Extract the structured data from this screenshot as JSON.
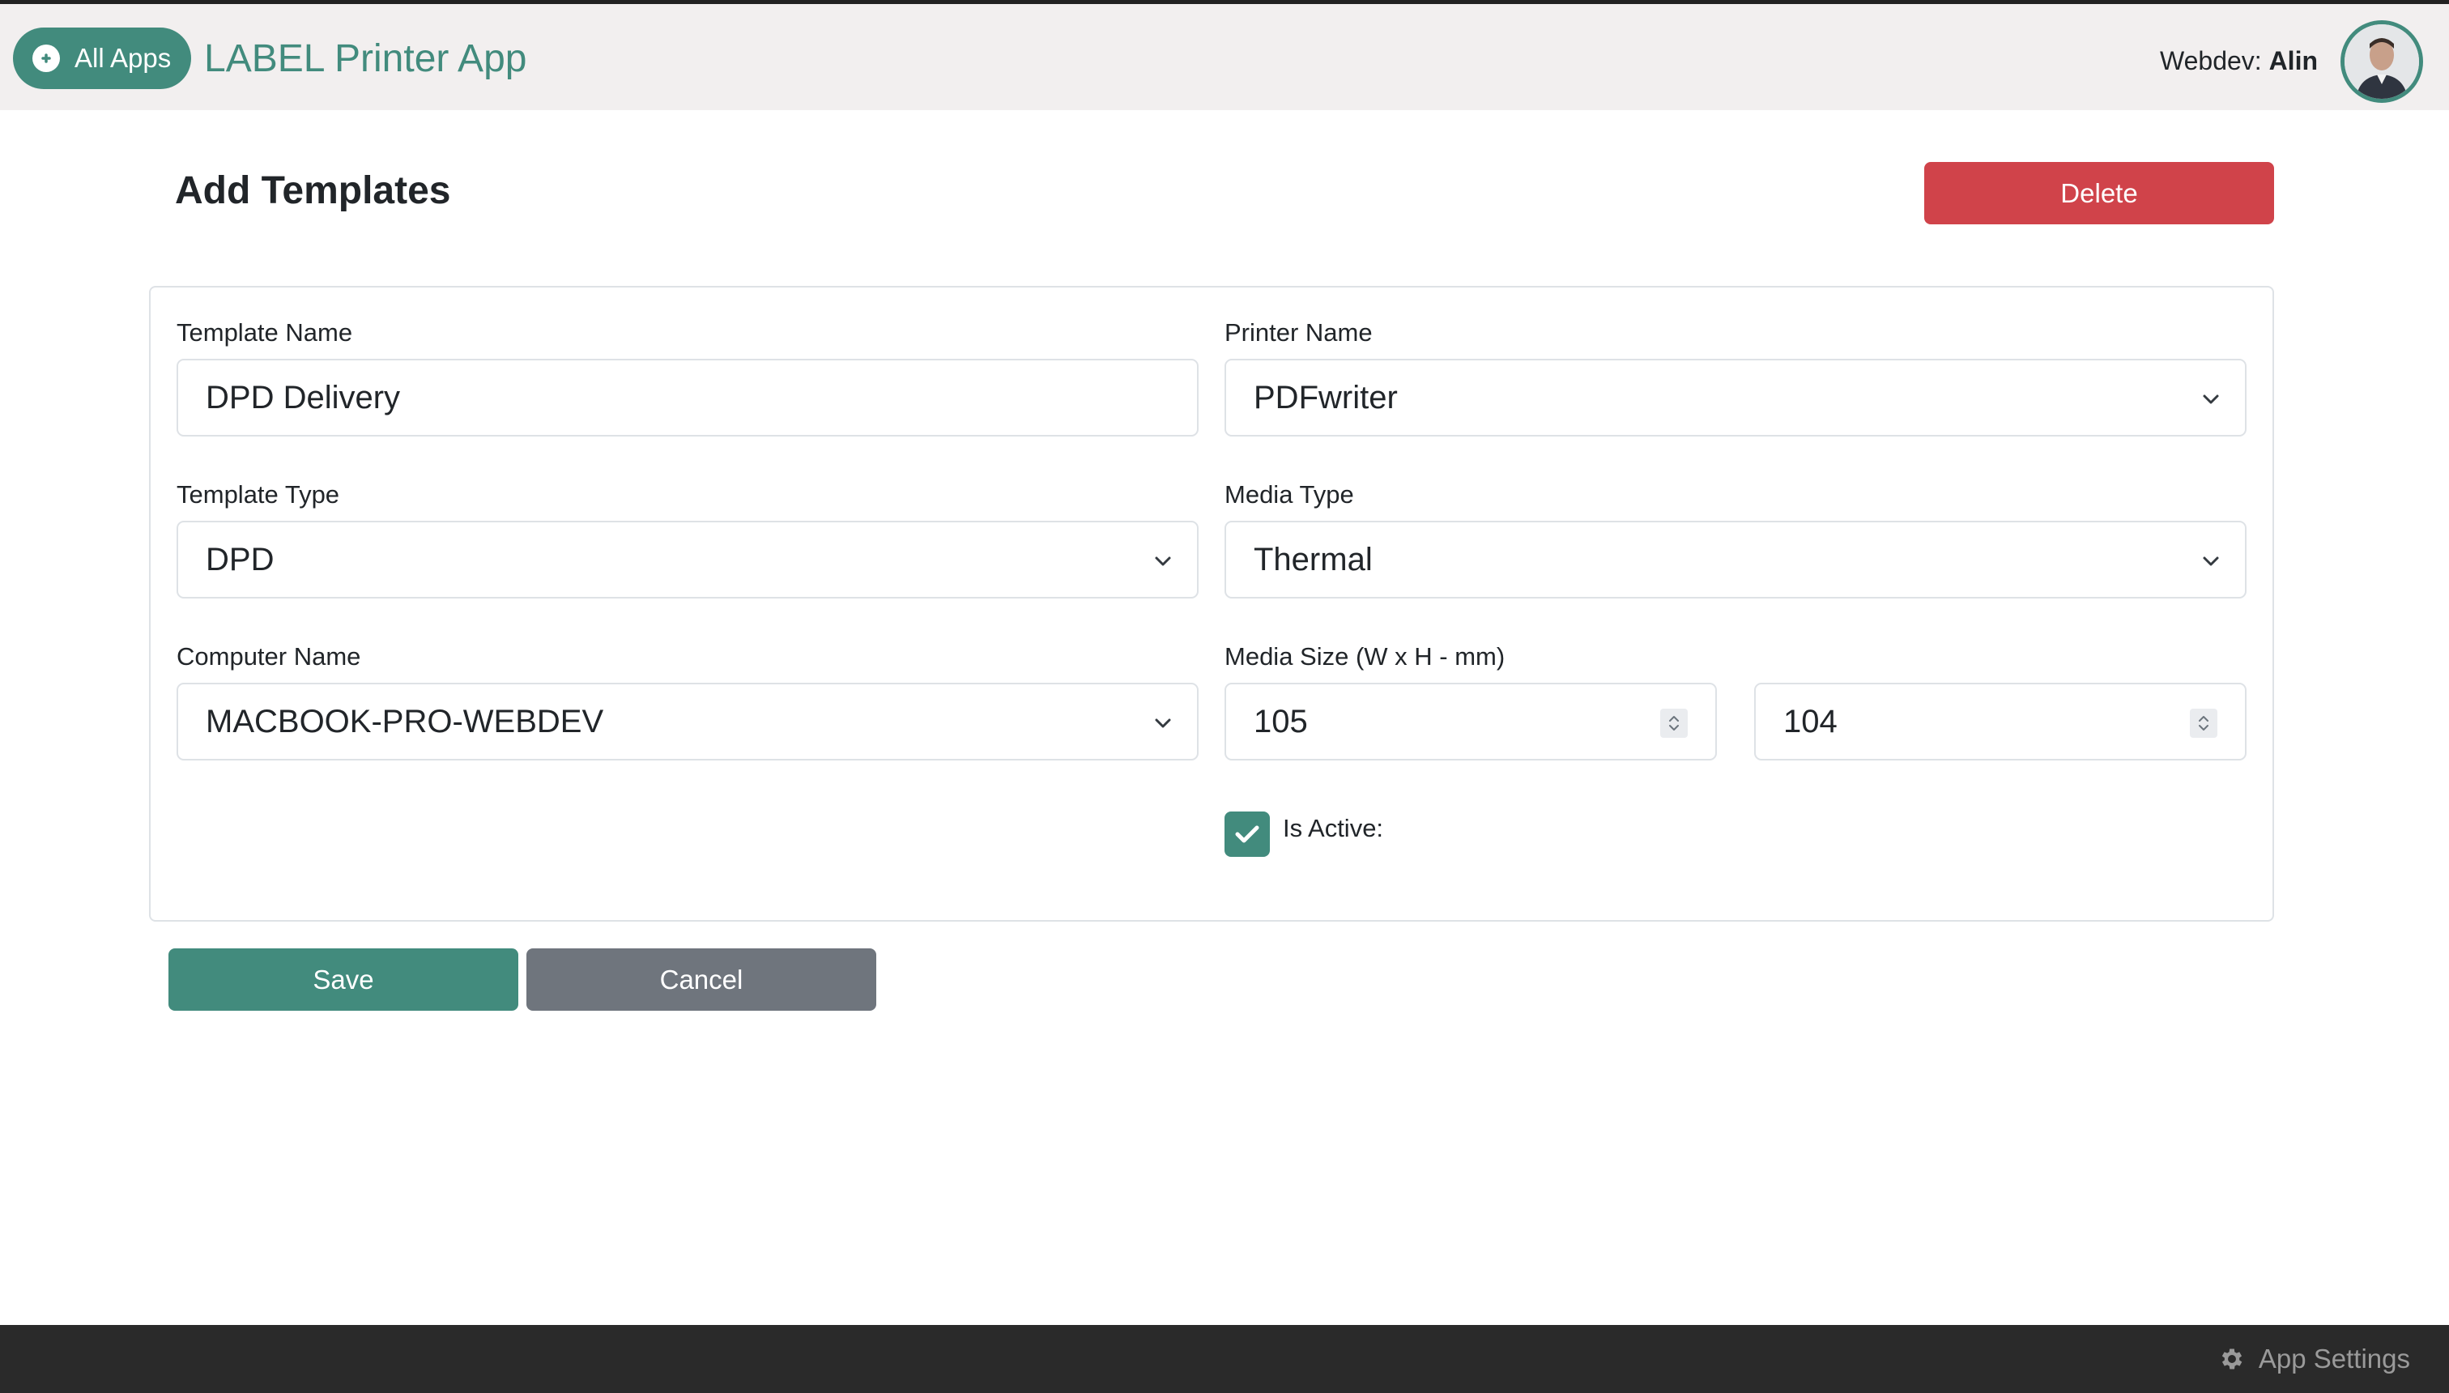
{
  "header": {
    "all_apps_label": "All Apps",
    "app_title": "LABEL Printer App",
    "user_prefix": "Webdev:",
    "user_name": "Alin"
  },
  "page": {
    "title": "Add Templates",
    "delete_label": "Delete",
    "save_label": "Save",
    "cancel_label": "Cancel"
  },
  "form": {
    "template_name": {
      "label": "Template Name",
      "value": "DPD Delivery"
    },
    "printer_name": {
      "label": "Printer Name",
      "value": "PDFwriter"
    },
    "template_type": {
      "label": "Template Type",
      "value": "DPD"
    },
    "media_type": {
      "label": "Media Type",
      "value": "Thermal"
    },
    "computer_name": {
      "label": "Computer Name",
      "value": "MACBOOK-PRO-WEBDEV"
    },
    "media_size": {
      "label": "Media Size (W x H - mm)",
      "width": "105",
      "height": "104"
    },
    "is_active": {
      "label": "Is Active:",
      "checked": true
    }
  },
  "footer": {
    "settings_label": "App Settings"
  },
  "colors": {
    "accent": "#428b7d",
    "danger": "#d0434a",
    "secondary": "#6f757d",
    "footer_bg": "#2a2a2a"
  },
  "icons": {
    "all_apps": "plus-circle-icon",
    "select": "chevron-down-icon",
    "number": "spinner-arrows-icon",
    "checkbox": "check-icon",
    "settings": "gear-icon"
  }
}
